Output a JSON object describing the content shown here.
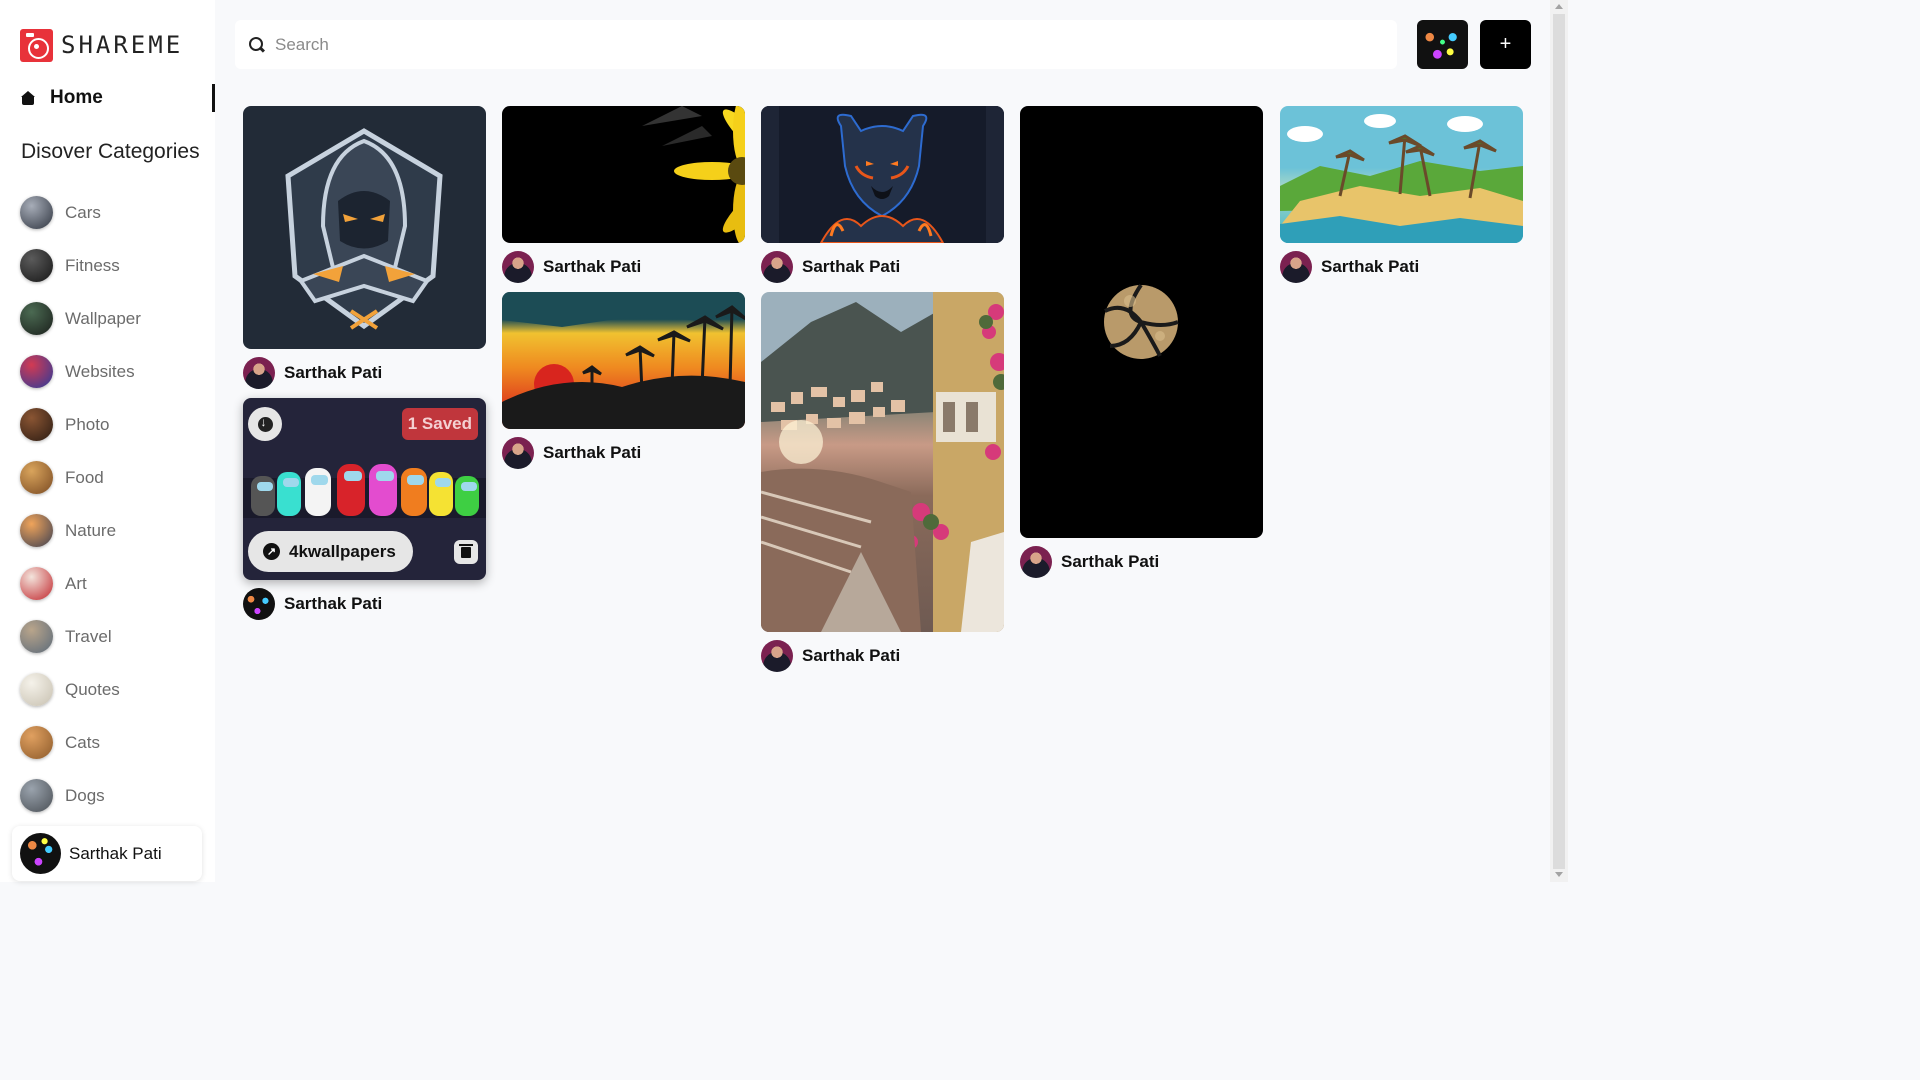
{
  "app": {
    "name": "SHAREME"
  },
  "nav": {
    "home_label": "Home"
  },
  "sidebar": {
    "categories_title": "Disover Categories",
    "categories": [
      {
        "label": "Cars",
        "colors": [
          "#a7adb8",
          "#2f3540"
        ]
      },
      {
        "label": "Fitness",
        "colors": [
          "#5b5b5b",
          "#161616"
        ]
      },
      {
        "label": "Wallpaper",
        "colors": [
          "#4b6a52",
          "#1a1f1b"
        ]
      },
      {
        "label": "Websites",
        "colors": [
          "#d33a52",
          "#2a3a9b"
        ]
      },
      {
        "label": "Photo",
        "colors": [
          "#8a5533",
          "#2b1b12"
        ]
      },
      {
        "label": "Food",
        "colors": [
          "#d9a45c",
          "#7a4a22"
        ]
      },
      {
        "label": "Nature",
        "colors": [
          "#f0a45a",
          "#3b3f52"
        ]
      },
      {
        "label": "Art",
        "colors": [
          "#f3e4dc",
          "#c1272d"
        ]
      },
      {
        "label": "Travel",
        "colors": [
          "#b9a58b",
          "#5b6a7a"
        ]
      },
      {
        "label": "Quotes",
        "colors": [
          "#f5f2ea",
          "#c7c0b0"
        ]
      },
      {
        "label": "Cats",
        "colors": [
          "#e0a060",
          "#8c5a2a"
        ]
      },
      {
        "label": "Dogs",
        "colors": [
          "#9aa3ad",
          "#4a4f55"
        ]
      }
    ]
  },
  "user": {
    "name": "Sarthak Pati"
  },
  "search": {
    "placeholder": "Search"
  },
  "topbar": {
    "add_symbol": "+"
  },
  "pins": [
    {
      "author": "Sarthak Pati",
      "image": "hooded-mascot-logo"
    },
    {
      "author": "Sarthak Pati",
      "image": "among-us-crewmates",
      "saved_label": "1 Saved",
      "link_label": "4kwallpapers"
    },
    {
      "author": "Sarthak Pati",
      "image": "yellow-flower-dark"
    },
    {
      "author": "Sarthak Pati",
      "image": "sunset-palm-silhouette"
    },
    {
      "author": "Sarthak Pati",
      "image": "neon-dog-portrait"
    },
    {
      "author": "Sarthak Pati",
      "image": "coastal-village-flowers"
    },
    {
      "author": "Sarthak Pati",
      "image": "glitter-volleyball"
    },
    {
      "author": "Sarthak Pati",
      "image": "low-poly-island"
    }
  ]
}
